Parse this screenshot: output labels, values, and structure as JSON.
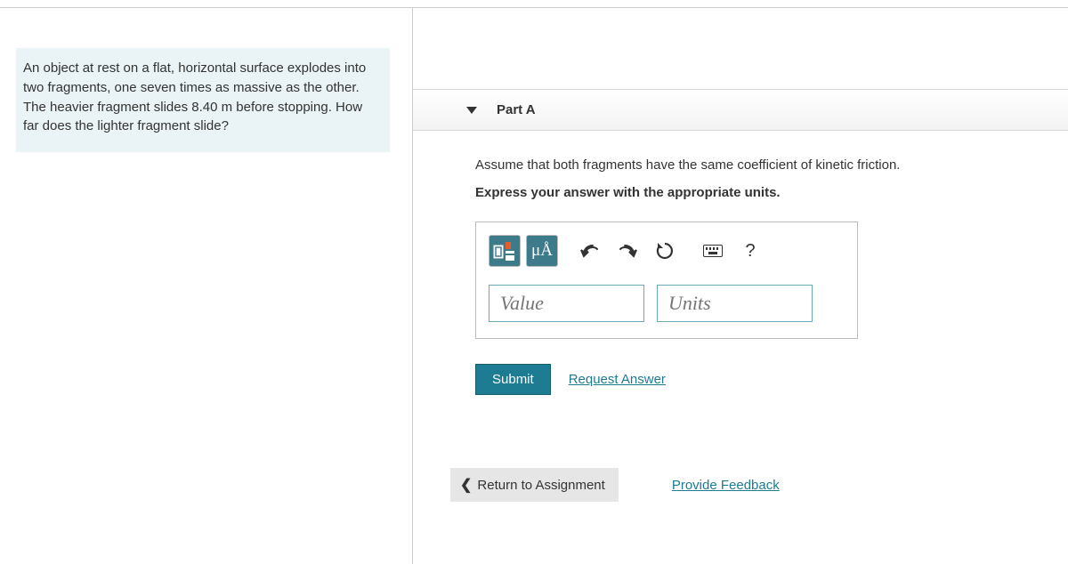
{
  "problem": {
    "text": "An object at rest on a flat, horizontal surface explodes into two fragments, one seven times as massive as the other. The heavier fragment slides 8.40 m before stopping. How far does the lighter fragment slide?"
  },
  "part": {
    "label": "Part A",
    "assumption": "Assume that both fragments have the same coefficient of kinetic friction.",
    "instruction": "Express your answer with the appropriate units."
  },
  "toolbar": {
    "microA": "μÅ",
    "help": "?"
  },
  "inputs": {
    "value_placeholder": "Value",
    "units_placeholder": "Units"
  },
  "actions": {
    "submit": "Submit",
    "request_answer": "Request Answer",
    "return": "Return to Assignment",
    "feedback": "Provide Feedback"
  }
}
